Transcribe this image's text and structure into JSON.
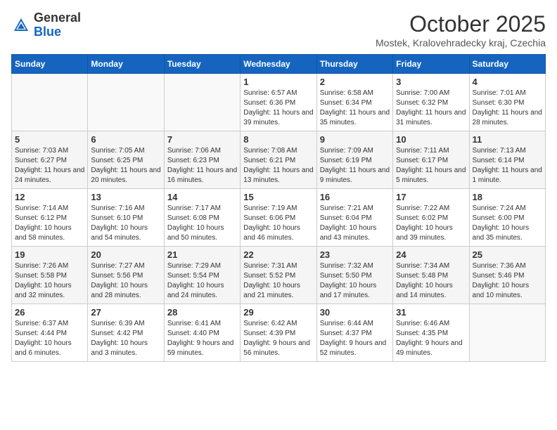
{
  "header": {
    "logo_general": "General",
    "logo_blue": "Blue",
    "month_title": "October 2025",
    "subtitle": "Mostek, Kralovehradecky kraj, Czechia"
  },
  "days_of_week": [
    "Sunday",
    "Monday",
    "Tuesday",
    "Wednesday",
    "Thursday",
    "Friday",
    "Saturday"
  ],
  "weeks": [
    [
      {
        "day": "",
        "info": ""
      },
      {
        "day": "",
        "info": ""
      },
      {
        "day": "",
        "info": ""
      },
      {
        "day": "1",
        "info": "Sunrise: 6:57 AM\nSunset: 6:36 PM\nDaylight: 11 hours and 39 minutes."
      },
      {
        "day": "2",
        "info": "Sunrise: 6:58 AM\nSunset: 6:34 PM\nDaylight: 11 hours and 35 minutes."
      },
      {
        "day": "3",
        "info": "Sunrise: 7:00 AM\nSunset: 6:32 PM\nDaylight: 11 hours and 31 minutes."
      },
      {
        "day": "4",
        "info": "Sunrise: 7:01 AM\nSunset: 6:30 PM\nDaylight: 11 hours and 28 minutes."
      }
    ],
    [
      {
        "day": "5",
        "info": "Sunrise: 7:03 AM\nSunset: 6:27 PM\nDaylight: 11 hours and 24 minutes."
      },
      {
        "day": "6",
        "info": "Sunrise: 7:05 AM\nSunset: 6:25 PM\nDaylight: 11 hours and 20 minutes."
      },
      {
        "day": "7",
        "info": "Sunrise: 7:06 AM\nSunset: 6:23 PM\nDaylight: 11 hours and 16 minutes."
      },
      {
        "day": "8",
        "info": "Sunrise: 7:08 AM\nSunset: 6:21 PM\nDaylight: 11 hours and 13 minutes."
      },
      {
        "day": "9",
        "info": "Sunrise: 7:09 AM\nSunset: 6:19 PM\nDaylight: 11 hours and 9 minutes."
      },
      {
        "day": "10",
        "info": "Sunrise: 7:11 AM\nSunset: 6:17 PM\nDaylight: 11 hours and 5 minutes."
      },
      {
        "day": "11",
        "info": "Sunrise: 7:13 AM\nSunset: 6:14 PM\nDaylight: 11 hours and 1 minute."
      }
    ],
    [
      {
        "day": "12",
        "info": "Sunrise: 7:14 AM\nSunset: 6:12 PM\nDaylight: 10 hours and 58 minutes."
      },
      {
        "day": "13",
        "info": "Sunrise: 7:16 AM\nSunset: 6:10 PM\nDaylight: 10 hours and 54 minutes."
      },
      {
        "day": "14",
        "info": "Sunrise: 7:17 AM\nSunset: 6:08 PM\nDaylight: 10 hours and 50 minutes."
      },
      {
        "day": "15",
        "info": "Sunrise: 7:19 AM\nSunset: 6:06 PM\nDaylight: 10 hours and 46 minutes."
      },
      {
        "day": "16",
        "info": "Sunrise: 7:21 AM\nSunset: 6:04 PM\nDaylight: 10 hours and 43 minutes."
      },
      {
        "day": "17",
        "info": "Sunrise: 7:22 AM\nSunset: 6:02 PM\nDaylight: 10 hours and 39 minutes."
      },
      {
        "day": "18",
        "info": "Sunrise: 7:24 AM\nSunset: 6:00 PM\nDaylight: 10 hours and 35 minutes."
      }
    ],
    [
      {
        "day": "19",
        "info": "Sunrise: 7:26 AM\nSunset: 5:58 PM\nDaylight: 10 hours and 32 minutes."
      },
      {
        "day": "20",
        "info": "Sunrise: 7:27 AM\nSunset: 5:56 PM\nDaylight: 10 hours and 28 minutes."
      },
      {
        "day": "21",
        "info": "Sunrise: 7:29 AM\nSunset: 5:54 PM\nDaylight: 10 hours and 24 minutes."
      },
      {
        "day": "22",
        "info": "Sunrise: 7:31 AM\nSunset: 5:52 PM\nDaylight: 10 hours and 21 minutes."
      },
      {
        "day": "23",
        "info": "Sunrise: 7:32 AM\nSunset: 5:50 PM\nDaylight: 10 hours and 17 minutes."
      },
      {
        "day": "24",
        "info": "Sunrise: 7:34 AM\nSunset: 5:48 PM\nDaylight: 10 hours and 14 minutes."
      },
      {
        "day": "25",
        "info": "Sunrise: 7:36 AM\nSunset: 5:46 PM\nDaylight: 10 hours and 10 minutes."
      }
    ],
    [
      {
        "day": "26",
        "info": "Sunrise: 6:37 AM\nSunset: 4:44 PM\nDaylight: 10 hours and 6 minutes."
      },
      {
        "day": "27",
        "info": "Sunrise: 6:39 AM\nSunset: 4:42 PM\nDaylight: 10 hours and 3 minutes."
      },
      {
        "day": "28",
        "info": "Sunrise: 6:41 AM\nSunset: 4:40 PM\nDaylight: 9 hours and 59 minutes."
      },
      {
        "day": "29",
        "info": "Sunrise: 6:42 AM\nSunset: 4:39 PM\nDaylight: 9 hours and 56 minutes."
      },
      {
        "day": "30",
        "info": "Sunrise: 6:44 AM\nSunset: 4:37 PM\nDaylight: 9 hours and 52 minutes."
      },
      {
        "day": "31",
        "info": "Sunrise: 6:46 AM\nSunset: 4:35 PM\nDaylight: 9 hours and 49 minutes."
      },
      {
        "day": "",
        "info": ""
      }
    ]
  ]
}
